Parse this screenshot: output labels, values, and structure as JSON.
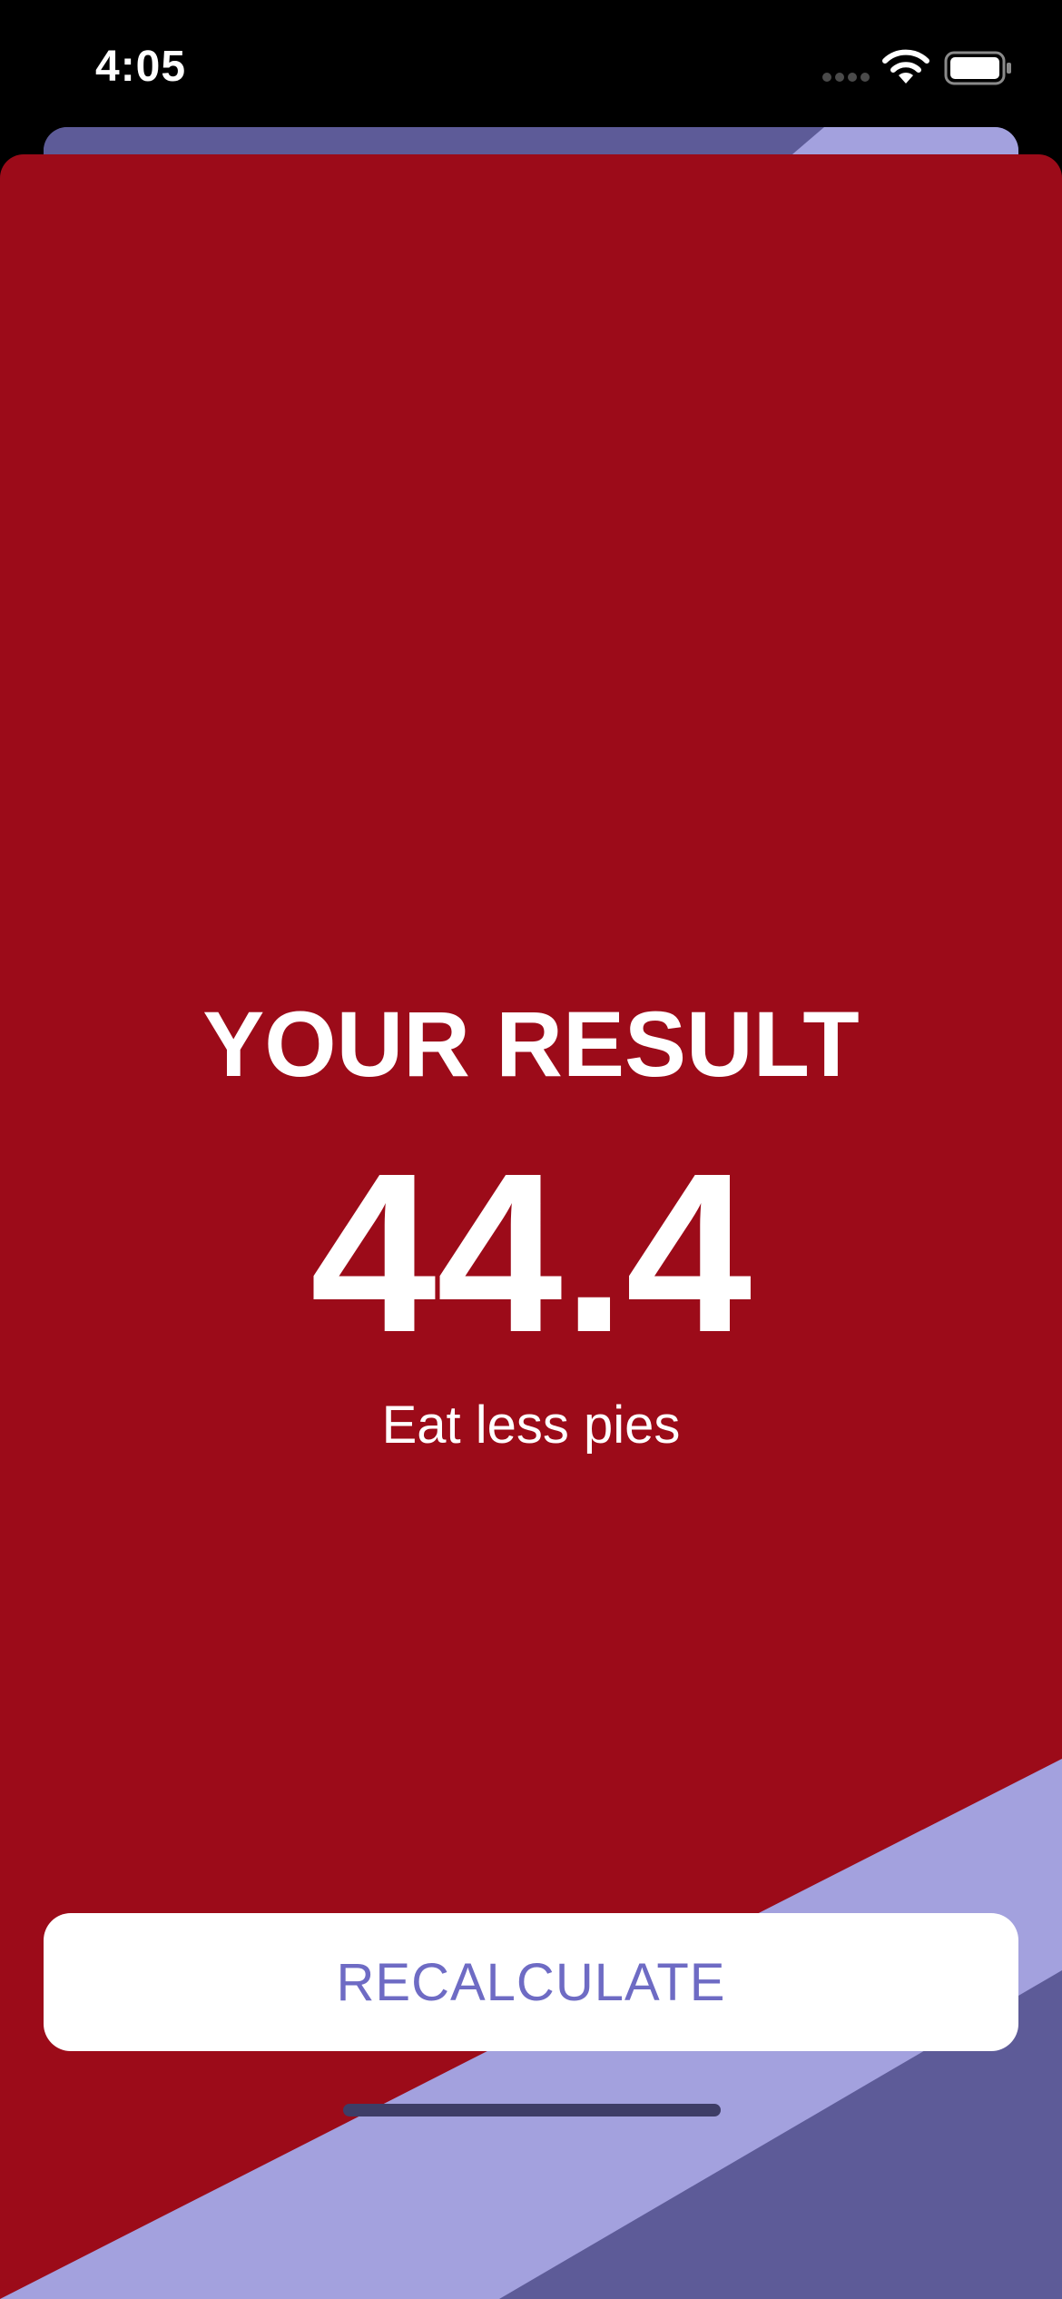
{
  "status_bar": {
    "time": "4:05",
    "icons": [
      "cellular-signal-icon",
      "wifi-icon",
      "battery-icon"
    ]
  },
  "result": {
    "title": "YOUR RESULT",
    "value": "44.4",
    "advice": "Eat less pies"
  },
  "actions": {
    "recalculate_label": "RECALCULATE"
  },
  "colors": {
    "sheet_background": "#9c0b19",
    "accent_light": "#a3a1de",
    "accent_dark": "#5d5b98",
    "button_text": "#6e6bc4",
    "button_background": "#ffffff"
  }
}
